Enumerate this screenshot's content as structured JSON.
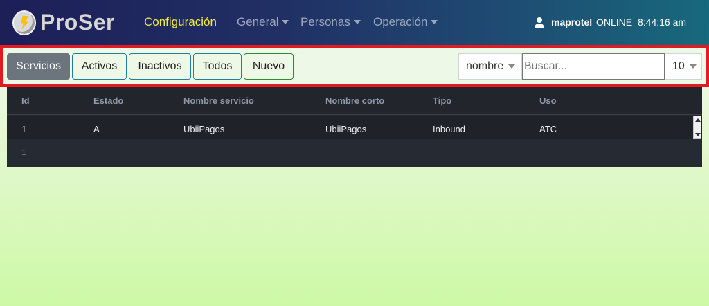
{
  "brand": {
    "name": "ProSer"
  },
  "nav": {
    "items": [
      {
        "label": "Configuración",
        "active": true,
        "dropdown": false
      },
      {
        "label": "General",
        "active": false,
        "dropdown": true
      },
      {
        "label": "Personas",
        "active": false,
        "dropdown": true
      },
      {
        "label": "Operación",
        "active": false,
        "dropdown": true
      }
    ],
    "user": "maprotel",
    "status": "ONLINE",
    "time": "8:44:16 am"
  },
  "toolbar": {
    "buttons": [
      "Servicios",
      "Activos",
      "Inactivos",
      "Todos",
      "Nuevo"
    ],
    "field_select": "nombre",
    "search_placeholder": "Buscar...",
    "page_size": "10"
  },
  "table": {
    "columns": [
      "Id",
      "Estado",
      "Nombre servicio",
      "Nombre corto",
      "Tipo",
      "Uso"
    ],
    "rows": [
      [
        "1",
        "A",
        "UbiiPagos",
        "UbiiPagos",
        "Inbound",
        "ATC"
      ]
    ],
    "footer_count": "1"
  },
  "colors": {
    "accent_active_nav": "#f1ec3c",
    "highlight_border": "#e21b23",
    "primary_button": "#6c757d"
  }
}
